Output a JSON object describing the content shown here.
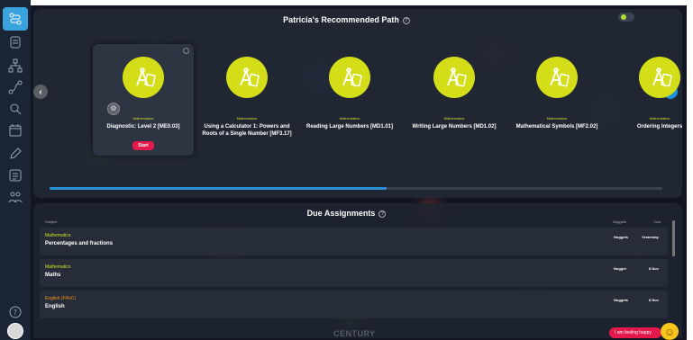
{
  "sidebar": {
    "items": [
      {
        "icon": "path-icon",
        "active": true
      },
      {
        "icon": "list-icon",
        "active": false
      },
      {
        "icon": "org-chart-icon",
        "active": false
      },
      {
        "icon": "route-icon",
        "active": false
      },
      {
        "icon": "search-doc-icon",
        "active": false
      },
      {
        "icon": "calendar-icon",
        "active": false
      },
      {
        "icon": "pencil-icon",
        "active": false
      },
      {
        "icon": "checklist-icon",
        "active": false
      },
      {
        "icon": "users-icon",
        "active": false
      },
      {
        "icon": "help-icon",
        "active": false
      }
    ]
  },
  "path": {
    "title": "Patricia's Recommended Path",
    "info": "?",
    "progress_percent": 55,
    "cards": [
      {
        "subject": "Mathematics",
        "title": "Diagnostic: Level 2 [ME0.03]",
        "start_label": "Start",
        "selected": true
      },
      {
        "subject": "Mathematics",
        "title": "Using a Calculator 1: Powers and Roots of a Single Number [MF3.17]",
        "selected": false
      },
      {
        "subject": "Mathematics",
        "title": "Reading Large Numbers [MD1.01]",
        "selected": false
      },
      {
        "subject": "Mathematics",
        "title": "Writing Large Numbers [MD1.02]",
        "selected": false
      },
      {
        "subject": "Mathematics",
        "title": "Mathematical Symbols [MF2.02]",
        "selected": false
      },
      {
        "subject": "Mathematics",
        "title": "Ordering Integers",
        "selected": false
      }
    ]
  },
  "assignments": {
    "title": "Due Assignments",
    "info": "?",
    "columns": {
      "subject": "Subject",
      "type": "Nuggets",
      "due": "Due"
    },
    "rows": [
      {
        "subject": "Mathematics",
        "name": "Percentages and fractions",
        "type": "Nuggets",
        "due": "Yesterday",
        "subject_color": "#cfe02a"
      },
      {
        "subject": "Mathematics",
        "name": "Maths",
        "type": "Nugget",
        "due": "8 Nov",
        "subject_color": "#cfe02a"
      },
      {
        "subject": "English (FRoC)",
        "name": "English",
        "type": "Nuggets",
        "due": "8 Nov",
        "subject_color": "#f59a1a"
      }
    ]
  },
  "footer": {
    "brand": "CENTURY",
    "mood_button": "I am feeling happy",
    "mood_emoji": "☺"
  },
  "colors": {
    "accent": "#3aa2dc",
    "lime": "#d4de18",
    "start": "#e5184b"
  }
}
